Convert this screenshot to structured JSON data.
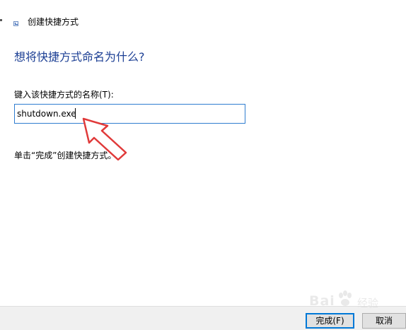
{
  "window": {
    "title": "创建快捷方式"
  },
  "main": {
    "heading": "想将快捷方式命名为什么?",
    "field_label": "键入该快捷方式的名称(T):",
    "name_value": "shutdown.exe",
    "instruction": "单击“完成”创建快捷方式。"
  },
  "footer": {
    "finish_label": "完成(F)",
    "cancel_label": "取消"
  },
  "watermark": {
    "brand": "Bai",
    "brand_suffix": "经验"
  },
  "colors": {
    "heading": "#1c3f94",
    "input_border": "#2f7dd0",
    "annotation_arrow": "#e03a3a",
    "default_button_border": "#0078d7"
  },
  "icons": {
    "title_icon": "shortcut-wizard-icon",
    "annotation": "red-arrow-annotation"
  }
}
